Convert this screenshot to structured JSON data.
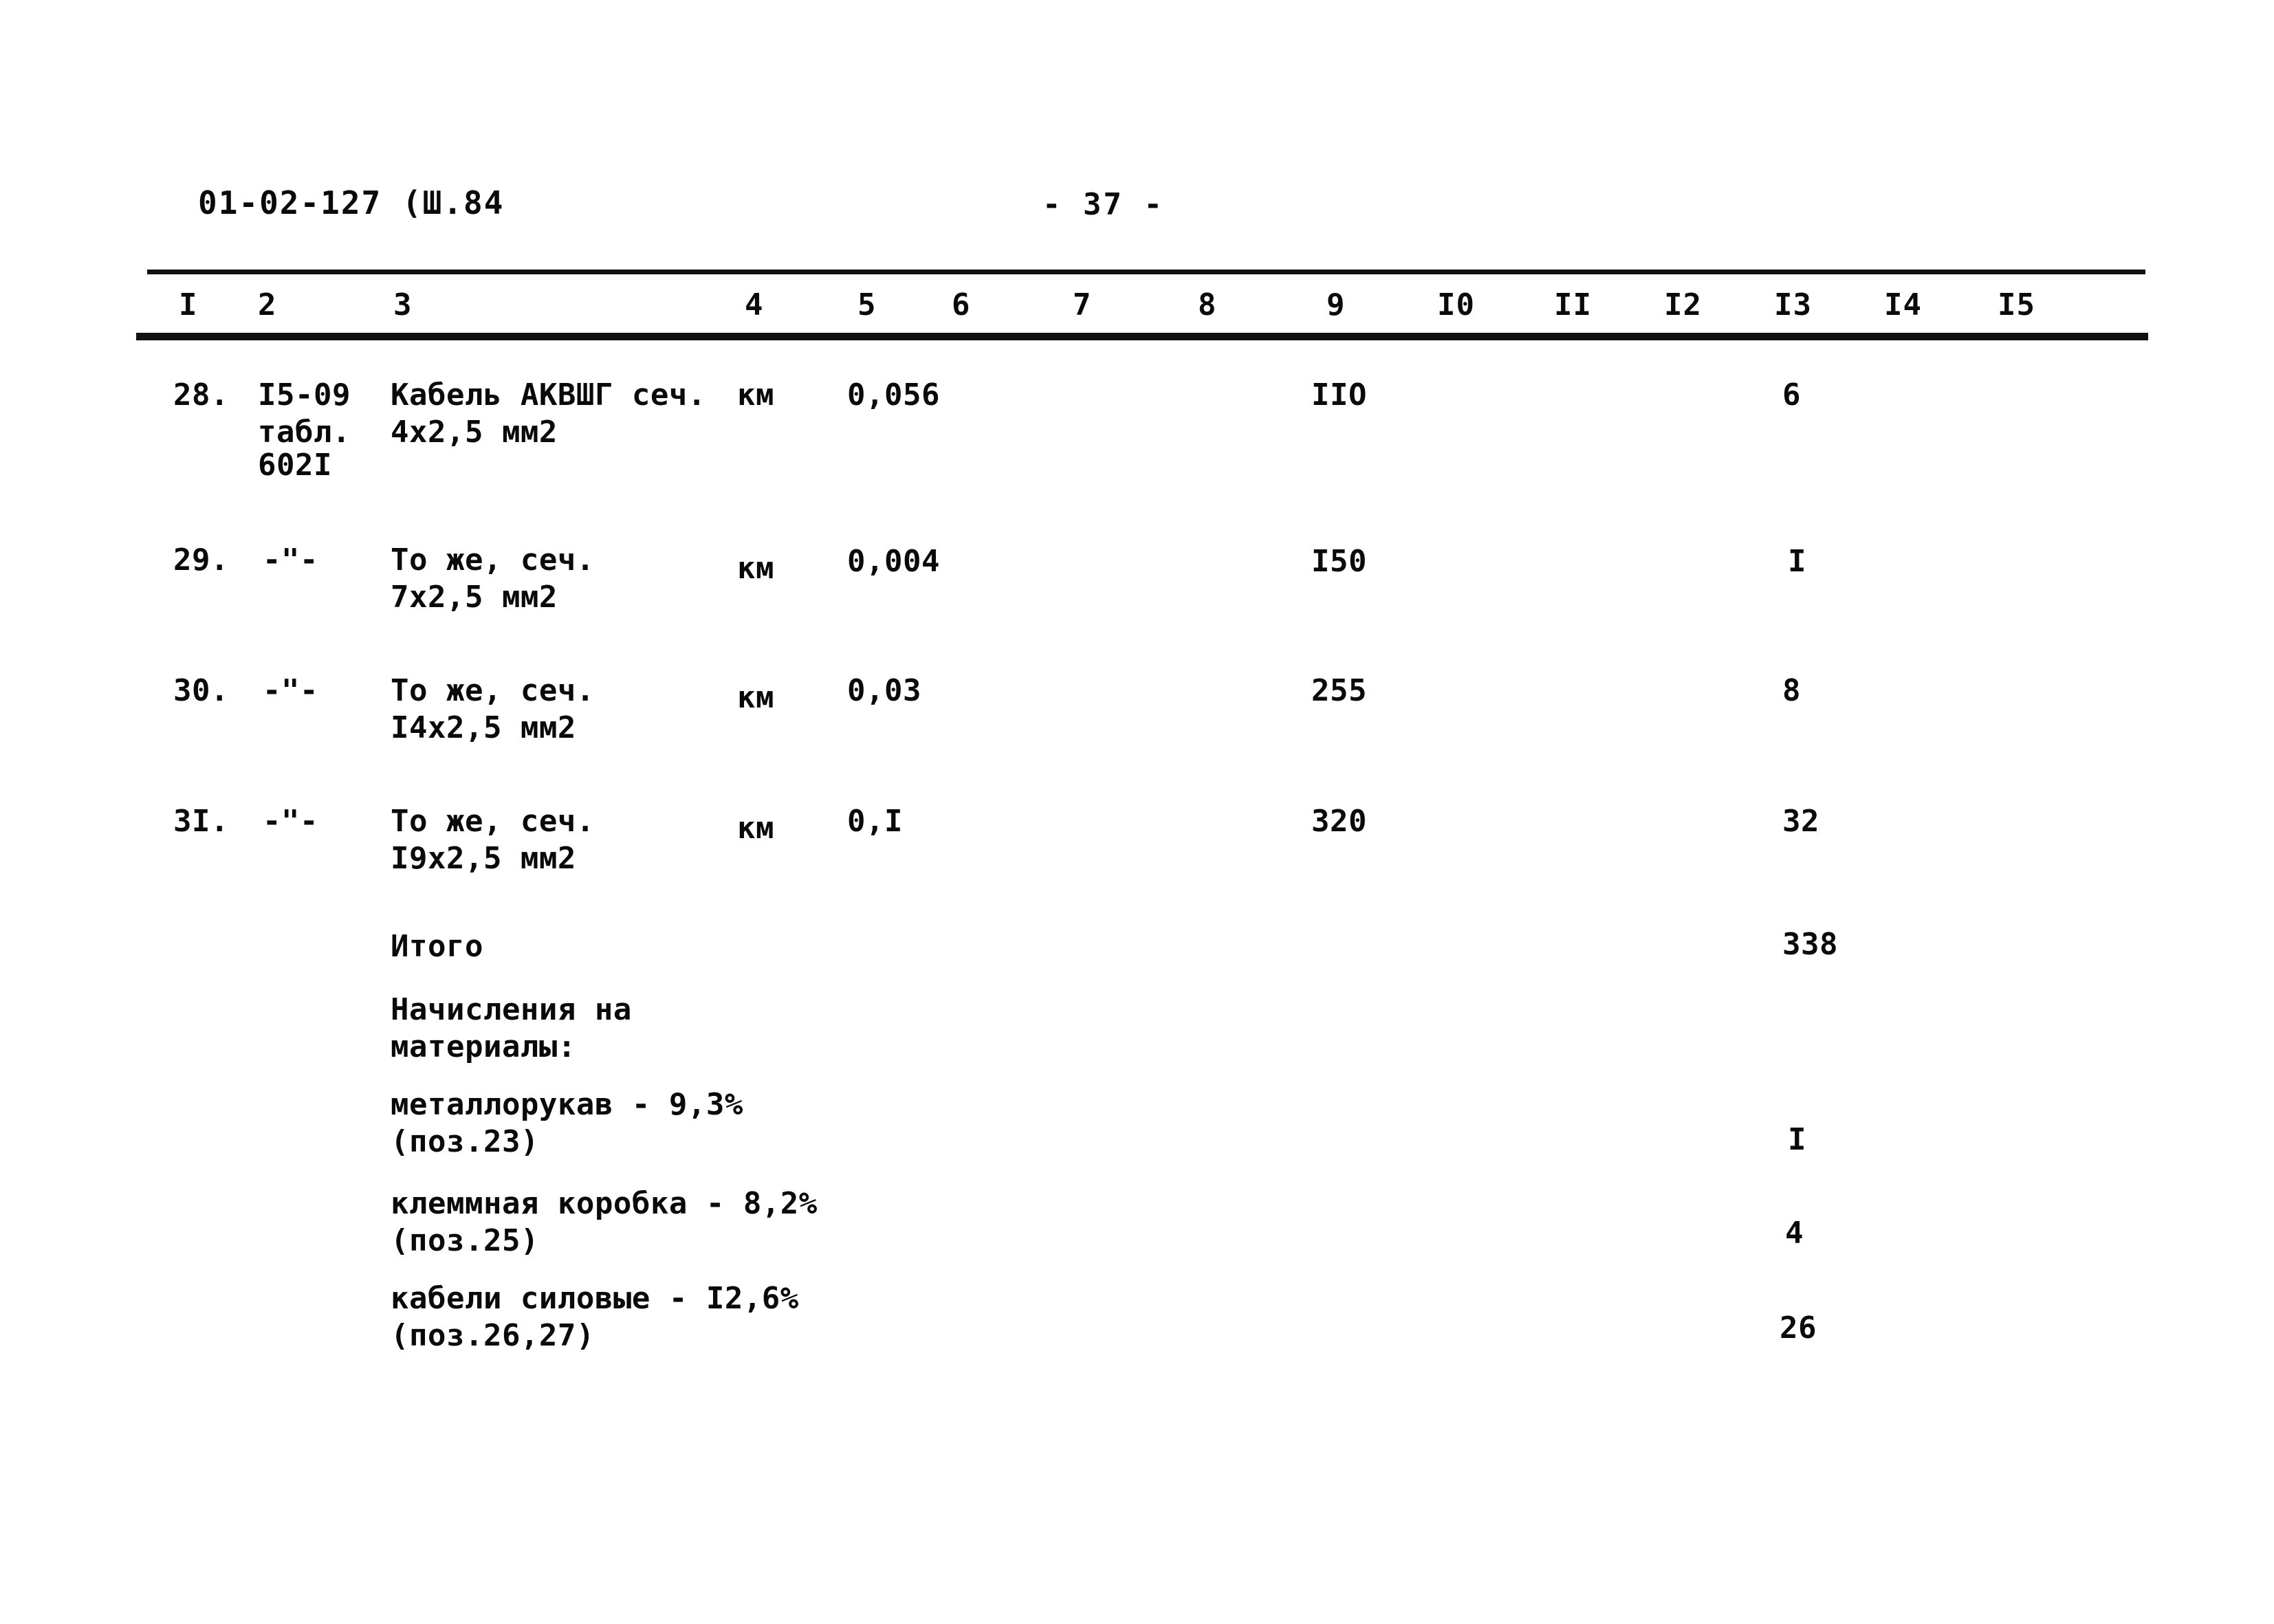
{
  "document": {
    "code": "01-02-127 (Ш.84",
    "page_label": "- 37 -"
  },
  "table": {
    "column_numbers": [
      "I",
      "2",
      "3",
      "4",
      "5",
      "6",
      "7",
      "8",
      "9",
      "I0",
      "II",
      "I2",
      "I3",
      "I4",
      "I5"
    ],
    "rows": [
      {
        "num": "28.",
        "code_line1": "I5-09",
        "code_line2": "табл.",
        "code_line3": "602I",
        "name_line1": "Кабель АКВШГ сеч.",
        "name_line2": "4х2,5 мм2",
        "unit": "км",
        "qty": "0,056",
        "col9": "IIO",
        "col13": "6"
      },
      {
        "num": "29.",
        "code_line1": "-\"-",
        "code_line2": "",
        "code_line3": "",
        "name_line1": "То же, сеч.",
        "name_line2": "7х2,5 мм2",
        "unit": "км",
        "qty": "0,004",
        "col9": "I50",
        "col13": "I"
      },
      {
        "num": "30.",
        "code_line1": "-\"-",
        "code_line2": "",
        "code_line3": "",
        "name_line1": "То же, сеч.",
        "name_line2": "I4х2,5 мм2",
        "unit": "км",
        "qty": "0,03",
        "col9": "255",
        "col13": "8"
      },
      {
        "num": "3I.",
        "code_line1": "-\"-",
        "code_line2": "",
        "code_line3": "",
        "name_line1": "То же, сеч.",
        "name_line2": "I9х2,5 мм2",
        "unit": "км",
        "qty": "0,I",
        "col9": "320",
        "col13": "32"
      }
    ],
    "total": {
      "label": "Итого",
      "value": "338"
    },
    "surcharges": {
      "heading_line1": "Начисления на",
      "heading_line2": "материалы:",
      "items": [
        {
          "label_line1": "металлорукав - 9,3%",
          "label_line2": "(поз.23)",
          "value": "I"
        },
        {
          "label_line1": "клеммная коробка - 8,2%",
          "label_line2": "(поз.25)",
          "value": "4"
        },
        {
          "label_line1": "кабели силовые - I2,6%",
          "label_line2": "(поз.26,27)",
          "value": "26"
        }
      ]
    }
  }
}
